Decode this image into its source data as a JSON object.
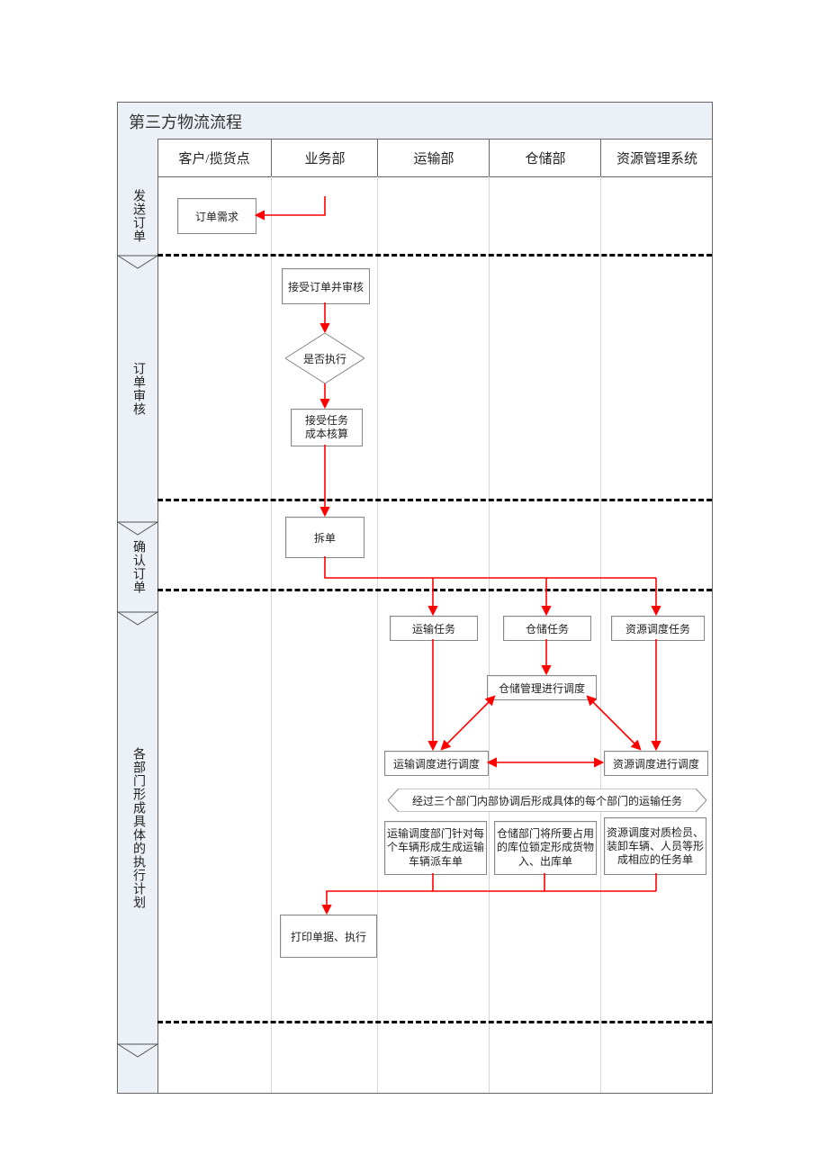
{
  "title": "第三方物流流程",
  "lanes": [
    "客户/揽货点",
    "业务部",
    "运输部",
    "仓储部",
    "资源管理系统"
  ],
  "phases": [
    "发送订单",
    "订单审核",
    "确认订单",
    "各部门形成具体的执行计划"
  ],
  "nodes": {
    "order_demand": "订单需求",
    "accept_review": "接受订单并审核",
    "decision": "是否执行",
    "accept_task_l1": "接受任务",
    "accept_task_l2": "成本核算",
    "split": "拆单",
    "transport_task": "运输任务",
    "storage_task": "仓储任务",
    "resource_task": "资源调度任务",
    "storage_sched": "仓储管理进行调度",
    "transport_sched": "运输调度进行调度",
    "resource_sched": "资源调度进行调度",
    "note": "经过三个部门内部协调后形成具体的每个部门的运输任务",
    "detail_transport": "运输调度部门针对每个车辆形成生成运输车辆派车单",
    "detail_storage": "仓储部门将所要占用的库位锁定形成货物入、出库单",
    "detail_resource": "资源调度对质检员、装卸车辆、人员等形成相应的任务单",
    "print_exec": "打印单据、执行"
  },
  "colors": {
    "arrow": "#ff0000",
    "band": "#ecf0f7"
  }
}
